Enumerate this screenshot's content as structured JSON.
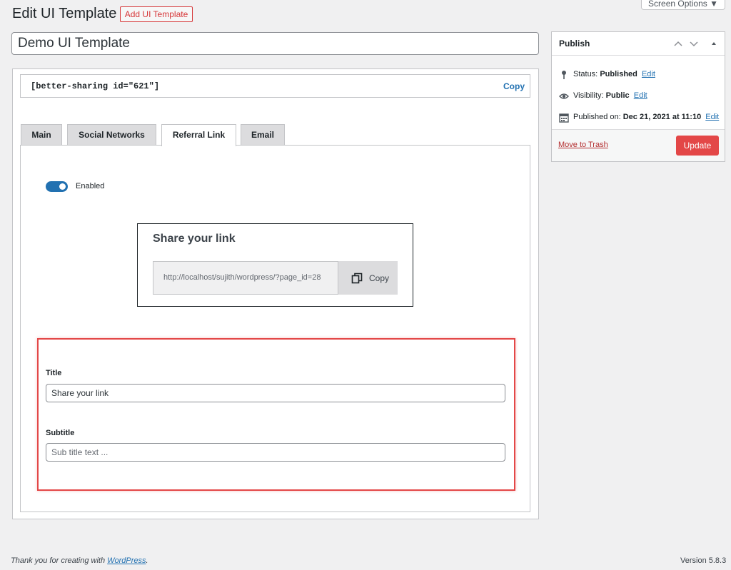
{
  "header": {
    "title": "Edit UI Template",
    "add_new_label": "Add UI Template",
    "screen_options_label": "Screen Options ▼"
  },
  "post_title": "Demo UI Template",
  "shortcode": {
    "text": "[better-sharing id=\"621\"]",
    "copy_label": "Copy"
  },
  "tabs": [
    {
      "label": "Main",
      "active": false
    },
    {
      "label": "Social Networks",
      "active": false
    },
    {
      "label": "Referral Link",
      "active": true
    },
    {
      "label": "Email",
      "active": false
    }
  ],
  "referral": {
    "toggle_label": "Enabled",
    "toggle_on": true,
    "preview": {
      "title": "Share your link",
      "url": "http://localhost/sujith/wordpress/?page_id=28",
      "copy_label": "Copy"
    },
    "fields": {
      "title_label": "Title",
      "title_value": "Share your link",
      "subtitle_label": "Subtitle",
      "subtitle_placeholder": "Sub title text ..."
    }
  },
  "publish": {
    "title": "Publish",
    "status_label": "Status:",
    "status_value": "Published",
    "visibility_label": "Visibility:",
    "visibility_value": "Public",
    "published_label": "Published on:",
    "published_value": "Dec 21, 2021 at 11:10",
    "edit_label": "Edit",
    "trash_label": "Move to Trash",
    "update_label": "Update"
  },
  "footer": {
    "thanks_prefix": "Thank you for creating with ",
    "thanks_link": "WordPress",
    "thanks_suffix": ".",
    "version": "Version 5.8.3"
  },
  "colors": {
    "accent": "#2271b1",
    "highlight": "#e34747",
    "update_button": "#e34747",
    "background": "#f0f0f1"
  }
}
